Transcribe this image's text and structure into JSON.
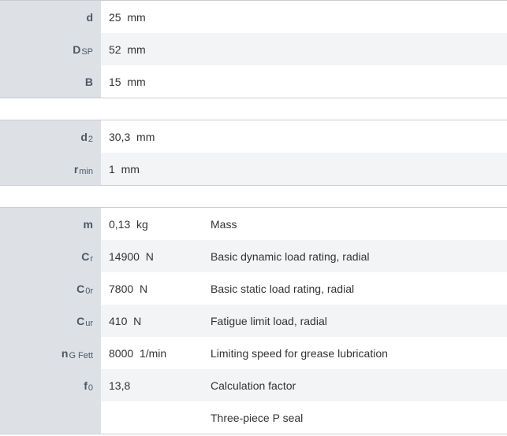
{
  "blocks": [
    {
      "rows": [
        {
          "symbol": "d",
          "sub": "",
          "value": "25",
          "unit": "mm",
          "desc": ""
        },
        {
          "symbol": "D",
          "sub": "SP",
          "value": "52",
          "unit": "mm",
          "desc": ""
        },
        {
          "symbol": "B",
          "sub": "",
          "value": "15",
          "unit": "mm",
          "desc": ""
        }
      ]
    },
    {
      "rows": [
        {
          "symbol": "d",
          "sub": "2",
          "value": "30,3",
          "unit": "mm",
          "desc": ""
        },
        {
          "symbol": "r",
          "sub": "min",
          "value": "1",
          "unit": "mm",
          "desc": ""
        }
      ]
    },
    {
      "rows": [
        {
          "symbol": "m",
          "sub": "",
          "value": "0,13",
          "unit": "kg",
          "desc": "Mass"
        },
        {
          "symbol": "C",
          "sub": "r",
          "value": "14900",
          "unit": "N",
          "desc": "Basic dynamic load rating, radial"
        },
        {
          "symbol": "C",
          "sub": "0r",
          "value": "7800",
          "unit": "N",
          "desc": "Basic static load rating, radial"
        },
        {
          "symbol": "C",
          "sub": "ur",
          "value": "410",
          "unit": "N",
          "desc": "Fatigue limit load, radial"
        },
        {
          "symbol": "n",
          "sub": "G Fett",
          "value": "8000",
          "unit": "1/min",
          "desc": "Limiting speed for grease lubrication"
        },
        {
          "symbol": "f",
          "sub": "0",
          "value": "13,8",
          "unit": "",
          "desc": "Calculation factor"
        },
        {
          "symbol": "",
          "sub": "",
          "value": "",
          "unit": "",
          "desc": "Three-piece P seal"
        }
      ]
    }
  ]
}
